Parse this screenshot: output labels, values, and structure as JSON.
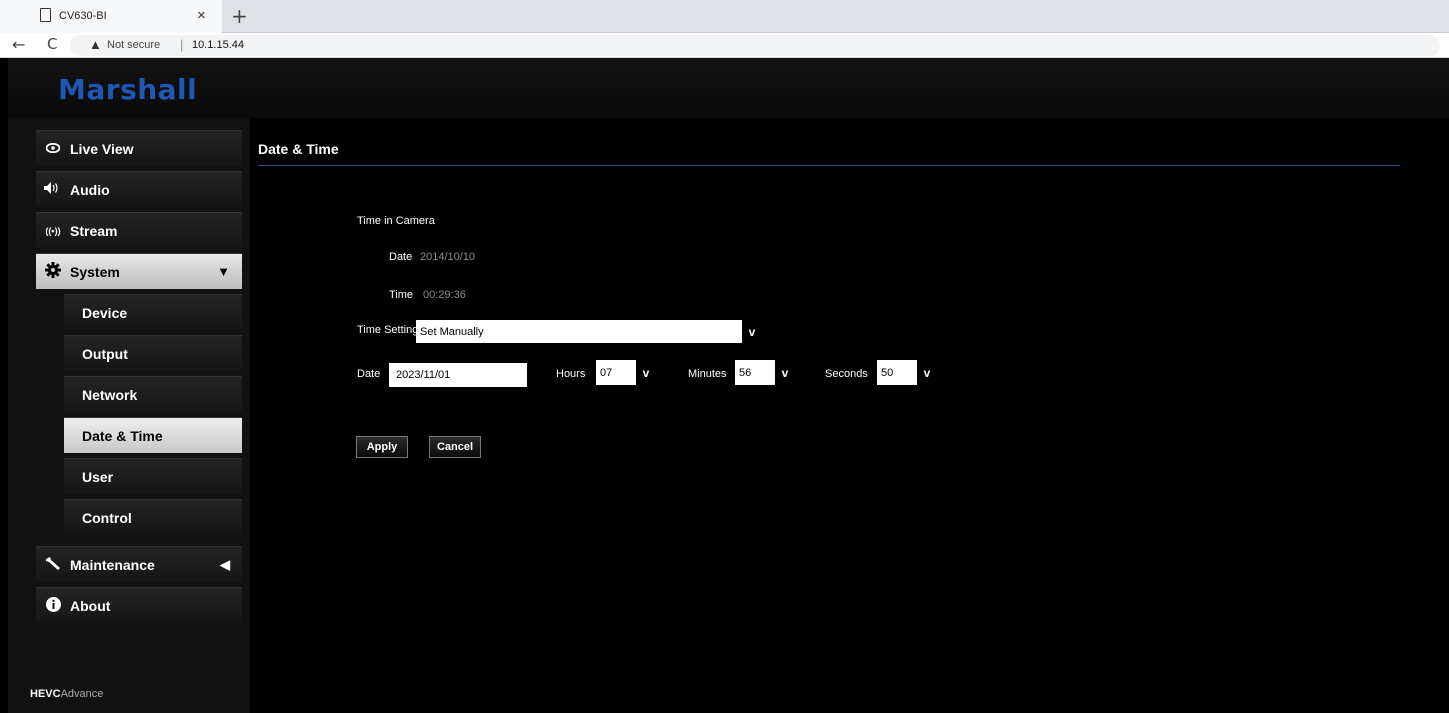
{
  "browser": {
    "tab_title": "CV630-BI",
    "close_glyph": "×",
    "newtab_glyph": "+",
    "back_glyph": "←",
    "reload_glyph": "C",
    "warning_glyph": "▲",
    "not_secure": "Not secure",
    "separator": "|",
    "url": "10.1.15.44"
  },
  "logo": "Marshall",
  "sidebar": {
    "items": [
      {
        "label": "Live View",
        "icon": "eye-icon",
        "glyph": "👁"
      },
      {
        "label": "Audio",
        "icon": "speaker-icon",
        "glyph": "◀︎)"
      },
      {
        "label": "Stream",
        "icon": "broadcast-icon",
        "glyph": "((•))"
      },
      {
        "label": "System",
        "icon": "gear-icon",
        "glyph": "✿",
        "caret": "▼"
      },
      {
        "label": "Maintenance",
        "icon": "wrench-icon",
        "glyph": "🔧",
        "caret": "◀"
      },
      {
        "label": "About",
        "icon": "info-icon",
        "glyph": "ℹ"
      }
    ],
    "system_sub": [
      "Device",
      "Output",
      "Network",
      "Date & Time",
      "User",
      "Control"
    ],
    "footer_brand": "HEVC",
    "footer_rest": "Advance"
  },
  "main": {
    "title": "Date & Time",
    "time_in_camera": "Time in Camera",
    "cam_date_label": "Date",
    "cam_date_value": "2014/10/10",
    "cam_time_label": "Time",
    "cam_time_value": "00:29:36",
    "time_setting_label": "Time Setting",
    "time_setting_value": "Set Manually",
    "date_label": "Date",
    "date_value": "2023/11/01",
    "hours_label": "Hours",
    "hours_value": "07",
    "minutes_label": "Minutes",
    "minutes_value": "56",
    "seconds_label": "Seconds",
    "seconds_value": "50",
    "chevron": "v",
    "apply": "Apply",
    "cancel": "Cancel"
  }
}
